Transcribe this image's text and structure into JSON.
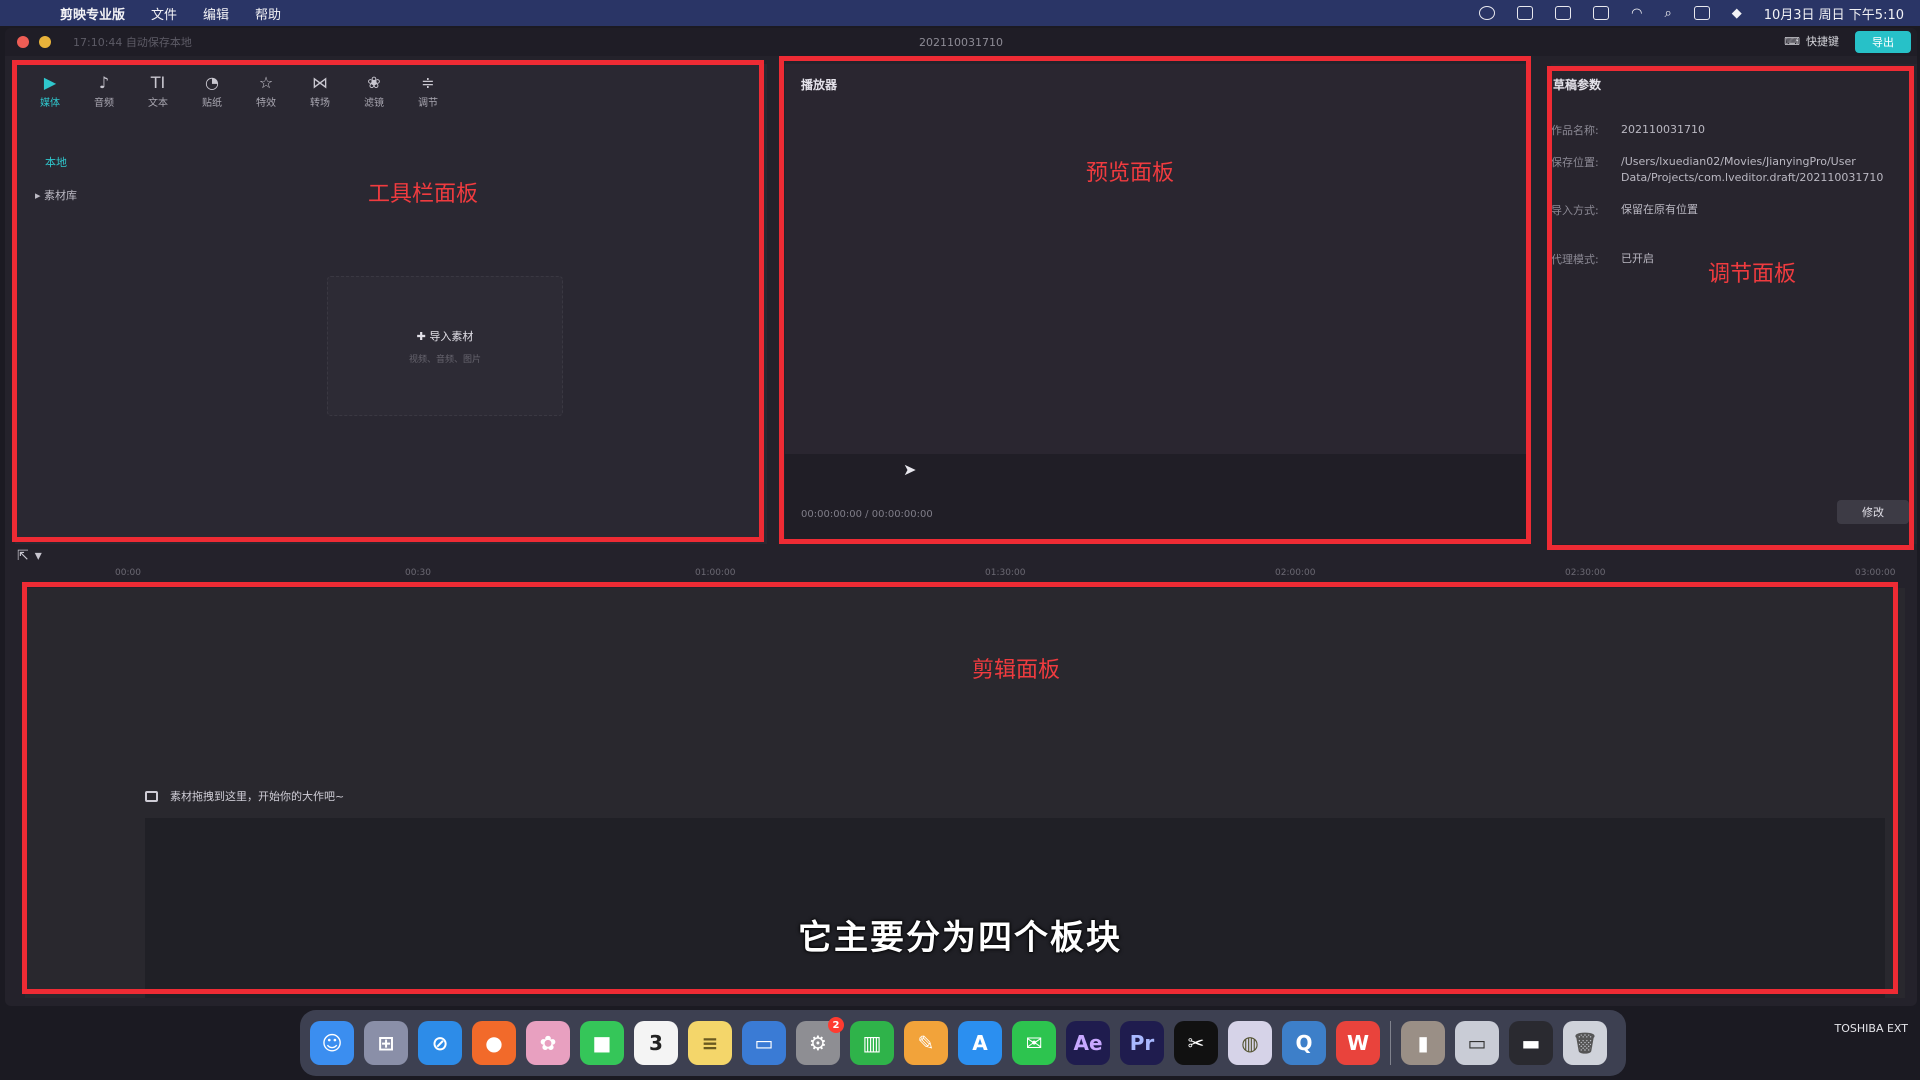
{
  "menubar": {
    "app_name": "剪映专业版",
    "items": [
      "文件",
      "编辑",
      "帮助"
    ],
    "clock": "10月3日 周日 下午5:10"
  },
  "window": {
    "autosave": "17:10:44 自动保存本地",
    "title": "202110031710",
    "shortcut_label": "快捷键",
    "export_label": "导出"
  },
  "media_panel": {
    "tools": [
      {
        "label": "媒体",
        "icon": "media-icon",
        "glyph": "▶"
      },
      {
        "label": "音频",
        "icon": "audio-icon",
        "glyph": "♪"
      },
      {
        "label": "文本",
        "icon": "text-icon",
        "glyph": "TI"
      },
      {
        "label": "贴纸",
        "icon": "sticker-icon",
        "glyph": "◔"
      },
      {
        "label": "特效",
        "icon": "effects-icon",
        "glyph": "☆"
      },
      {
        "label": "转场",
        "icon": "transition-icon",
        "glyph": "⋈"
      },
      {
        "label": "滤镜",
        "icon": "filter-icon",
        "glyph": "❀"
      },
      {
        "label": "调节",
        "icon": "adjust-icon",
        "glyph": "≑"
      }
    ],
    "local_tab": "本地",
    "library_tab": "素材库",
    "import_label": "导入素材",
    "import_sub": "视频、音频、图片"
  },
  "player_panel": {
    "title": "播放器",
    "time": "00:00:00:00 / 00:00:00:00"
  },
  "param_panel": {
    "title": "草稿参数",
    "rows": [
      {
        "key": "作品名称:",
        "value": "202110031710"
      },
      {
        "key": "保存位置:",
        "value": "/Users/lxuedian02/Movies/JianyingPro/User Data/Projects/com.lveditor.draft/202110031710"
      },
      {
        "key": "导入方式:",
        "value": "保留在原有位置"
      },
      {
        "key": "代理模式:",
        "value": "已开启"
      }
    ],
    "modify_label": "修改"
  },
  "timeline": {
    "ticks": [
      "00:00",
      "00:30",
      "01:00:00",
      "01:30:00",
      "02:00:00",
      "02:30:00",
      "03:00:00"
    ],
    "drop_hint": "素材拖拽到这里，开始你的大作吧~"
  },
  "annotations": {
    "toolbar_panel": "工具栏面板",
    "preview_panel": "预览面板",
    "adjust_panel": "调节面板",
    "edit_panel": "剪辑面板",
    "color": "#ee2b34"
  },
  "subtitle": "它主要分为四个板块",
  "dock": {
    "apps": [
      {
        "name": "finder-icon",
        "color": "#3b8ef0",
        "glyph": "☺"
      },
      {
        "name": "launchpad-icon",
        "color": "#8a8fa8",
        "glyph": "⊞"
      },
      {
        "name": "safari-icon",
        "color": "#2d8ce8",
        "glyph": "⊘"
      },
      {
        "name": "firefox-icon",
        "color": "#f26a2a",
        "glyph": "●"
      },
      {
        "name": "photos-icon",
        "color": "#e8a0c0",
        "glyph": "✿"
      },
      {
        "name": "facetime-icon",
        "color": "#35c659",
        "glyph": "■"
      },
      {
        "name": "calendar-icon",
        "color": "#f4f4f4",
        "glyph": "3"
      },
      {
        "name": "notes-icon",
        "color": "#f4d66a",
        "glyph": "≡"
      },
      {
        "name": "keynote-icon",
        "color": "#3a7bd5",
        "glyph": "▭"
      },
      {
        "name": "system-preferences-icon",
        "color": "#8e8e93",
        "glyph": "⚙",
        "badge": "2"
      },
      {
        "name": "numbers-icon",
        "color": "#2fb34a",
        "glyph": "▥"
      },
      {
        "name": "pages-icon",
        "color": "#f2a33a",
        "glyph": "✎"
      },
      {
        "name": "app-store-icon",
        "color": "#2b8ff0",
        "glyph": "A"
      },
      {
        "name": "wechat-icon",
        "color": "#2dc44f",
        "glyph": "✉"
      },
      {
        "name": "after-effects-icon",
        "color": "#1f1c4e",
        "glyph": "Ae"
      },
      {
        "name": "premiere-icon",
        "color": "#1f1c4e",
        "glyph": "Pr"
      },
      {
        "name": "capcut-icon",
        "color": "#111111",
        "glyph": "✂"
      },
      {
        "name": "palette-icon",
        "color": "#d6d3e8",
        "glyph": "◍"
      },
      {
        "name": "quicktime-icon",
        "color": "#3d7fc9",
        "glyph": "Q"
      },
      {
        "name": "wps-icon",
        "color": "#e9433c",
        "glyph": "W"
      }
    ],
    "extras": [
      {
        "name": "preview-thumbnail-icon",
        "color": "#9a8f86",
        "glyph": "▮"
      },
      {
        "name": "screen-recording-icon",
        "color": "#c9ccd6",
        "glyph": "▭"
      },
      {
        "name": "display-icon",
        "color": "#2a2a30",
        "glyph": "▬"
      },
      {
        "name": "trash-icon",
        "color": "#cfd2da",
        "glyph": "🗑"
      }
    ],
    "external_drive": "TOSHIBA EXT"
  }
}
